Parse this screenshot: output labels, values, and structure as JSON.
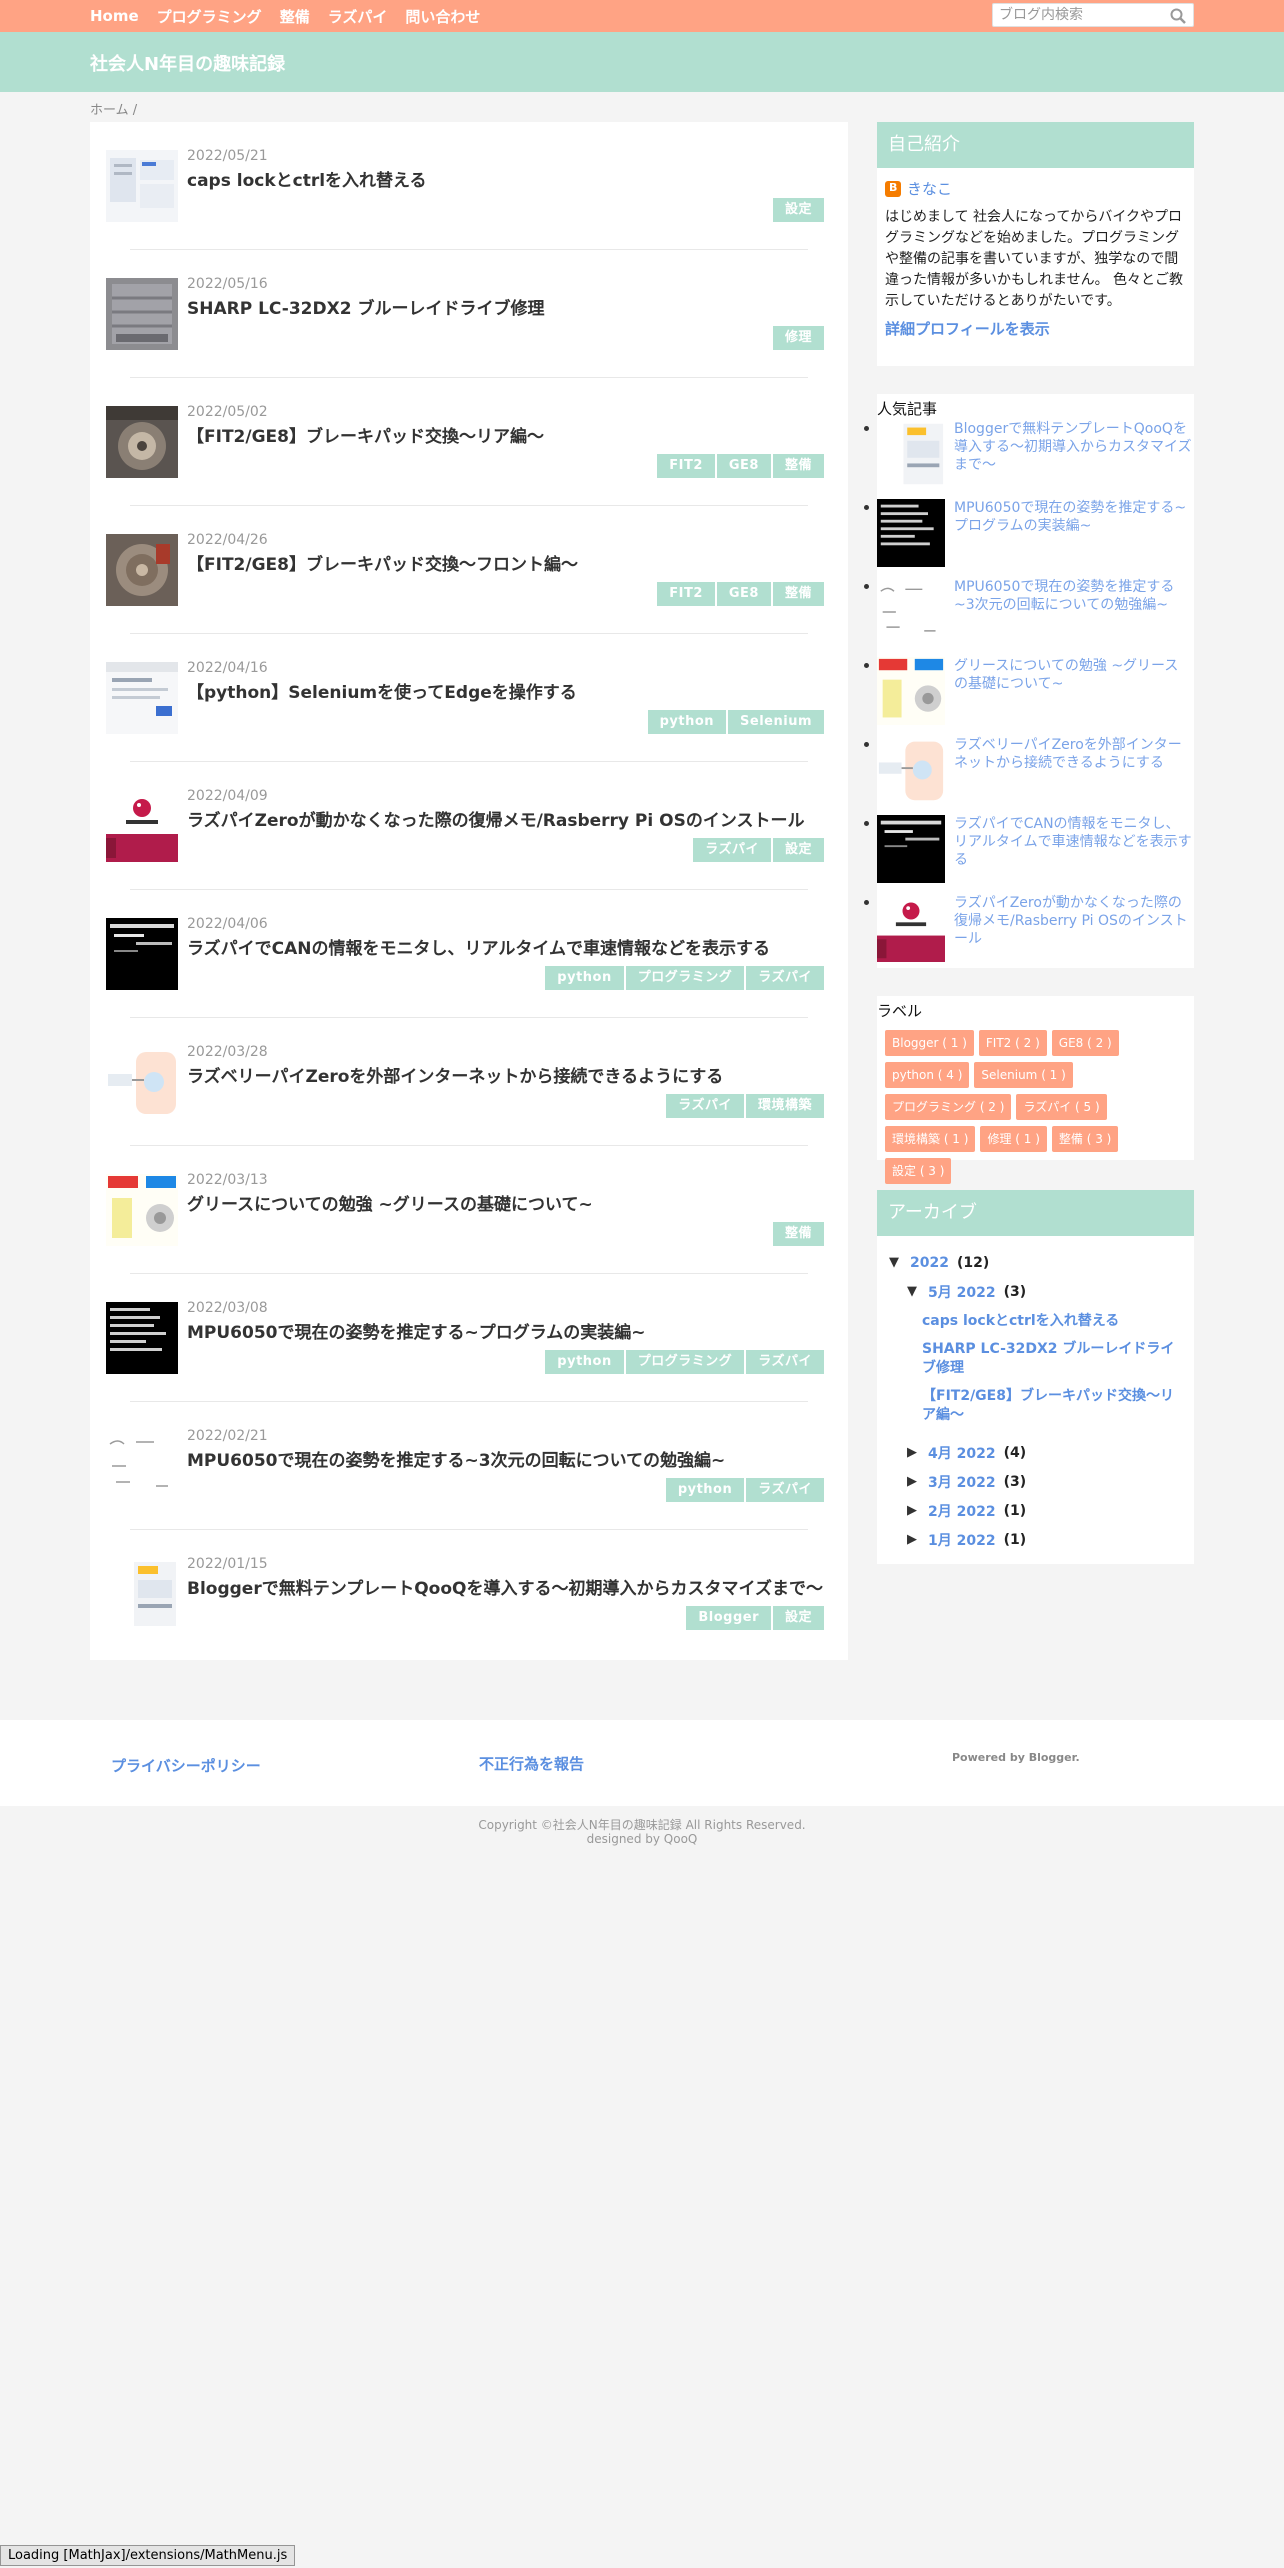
{
  "nav": {
    "items": [
      "Home",
      "プログラミング",
      "整備",
      "ラズパイ",
      "問い合わせ"
    ],
    "search_placeholder": "ブログ内検索"
  },
  "blog_title": "社会人N年目の趣味記録",
  "breadcrumb": "ホーム /",
  "posts": [
    {
      "date": "2022/05/21",
      "title": "caps lockとctrlを入れ替える",
      "tags": [
        "設定"
      ]
    },
    {
      "date": "2022/05/16",
      "title": "SHARP LC-32DX2 ブルーレイドライブ修理",
      "tags": [
        "修理"
      ]
    },
    {
      "date": "2022/05/02",
      "title": "【FIT2/GE8】ブレーキパッド交換～リア編～",
      "tags": [
        "FIT2",
        "GE8",
        "整備"
      ]
    },
    {
      "date": "2022/04/26",
      "title": "【FIT2/GE8】ブレーキパッド交換～フロント編～",
      "tags": [
        "FIT2",
        "GE8",
        "整備"
      ]
    },
    {
      "date": "2022/04/16",
      "title": "【python】Seleniumを使ってEdgeを操作する",
      "tags": [
        "python",
        "Selenium"
      ]
    },
    {
      "date": "2022/04/09",
      "title": "ラズパイZeroが動かなくなった際の復帰メモ/Rasberry Pi OSのインストール",
      "tags": [
        "ラズパイ",
        "設定"
      ]
    },
    {
      "date": "2022/04/06",
      "title": "ラズパイでCANの情報をモニタし、リアルタイムで車速情報などを表示する",
      "tags": [
        "python",
        "プログラミング",
        "ラズパイ"
      ]
    },
    {
      "date": "2022/03/28",
      "title": "ラズベリーパイZeroを外部インターネットから接続できるようにする",
      "tags": [
        "ラズパイ",
        "環境構築"
      ]
    },
    {
      "date": "2022/03/13",
      "title": "グリースについての勉強 ~グリースの基礎について~",
      "tags": [
        "整備"
      ]
    },
    {
      "date": "2022/03/08",
      "title": "MPU6050で現在の姿勢を推定する~プログラムの実装編~",
      "tags": [
        "python",
        "プログラミング",
        "ラズパイ"
      ]
    },
    {
      "date": "2022/02/21",
      "title": "MPU6050で現在の姿勢を推定する~3次元の回転についての勉強編~",
      "tags": [
        "python",
        "ラズパイ"
      ]
    },
    {
      "date": "2022/01/15",
      "title": "Bloggerで無料テンプレートQooQを導入する～初期導入からカスタマイズまで～",
      "tags": [
        "Blogger",
        "設定"
      ]
    }
  ],
  "profile": {
    "heading": "自己紹介",
    "name": "きなこ",
    "desc": "はじめまして 社会人になってからバイクやプログラミングなどを始めました。プログラミングや整備の記事を書いていますが、独学なので間違った情報が多いかもしれません。 色々とご教示していただけるとありがたいです。",
    "link": "詳細プロフィールを表示"
  },
  "popular": {
    "heading": "人気記事",
    "items": [
      "Bloggerで無料テンプレートQooQを導入する～初期導入からカスタマイズまで～",
      "MPU6050で現在の姿勢を推定する~プログラムの実装編~",
      "MPU6050で現在の姿勢を推定する~3次元の回転についての勉強編~",
      "グリースについての勉強 ~グリースの基礎について~",
      "ラズベリーパイZeroを外部インターネットから接続できるようにする",
      "ラズパイでCANの情報をモニタし、リアルタイムで車速情報などを表示する",
      "ラズパイZeroが動かなくなった際の復帰メモ/Rasberry Pi OSのインストール"
    ]
  },
  "labels": {
    "heading": "ラベル",
    "items": [
      "Blogger ( 1 )",
      "FIT2 ( 2 )",
      "GE8 ( 2 )",
      "python ( 4 )",
      "Selenium ( 1 )",
      "プログラミング ( 2 )",
      "ラズパイ ( 5 )",
      "環境構築 ( 1 )",
      "修理 ( 1 )",
      "整備 ( 3 )",
      "設定 ( 3 )"
    ]
  },
  "archive": {
    "heading": "アーカイブ",
    "year": "2022",
    "year_count": "(12)",
    "open_month": "5月 2022",
    "open_month_count": "(3)",
    "open_posts": [
      "caps lockとctrlを入れ替える",
      "SHARP LC-32DX2 ブルーレイドライブ修理",
      "【FIT2/GE8】ブレーキパッド交換～リア編～"
    ],
    "months": [
      {
        "label": "4月 2022",
        "count": "(4)"
      },
      {
        "label": "3月 2022",
        "count": "(3)"
      },
      {
        "label": "2月 2022",
        "count": "(1)"
      },
      {
        "label": "1月 2022",
        "count": "(1)"
      }
    ]
  },
  "footer": {
    "privacy": "プライバシーポリシー",
    "report": "不正行為を報告",
    "powered": "Powered by Blogger.",
    "copyright": "Copyright ©社会人N年目の趣味記録 All Rights Reserved.",
    "designed": "designed by QooQ"
  },
  "mathjax_status": "Loading [MathJax]/extensions/MathMenu.js",
  "colors": {
    "accent_green": "#b1dfd0",
    "accent_orange": "#ffa384",
    "link_blue": "#5b8fe0"
  }
}
